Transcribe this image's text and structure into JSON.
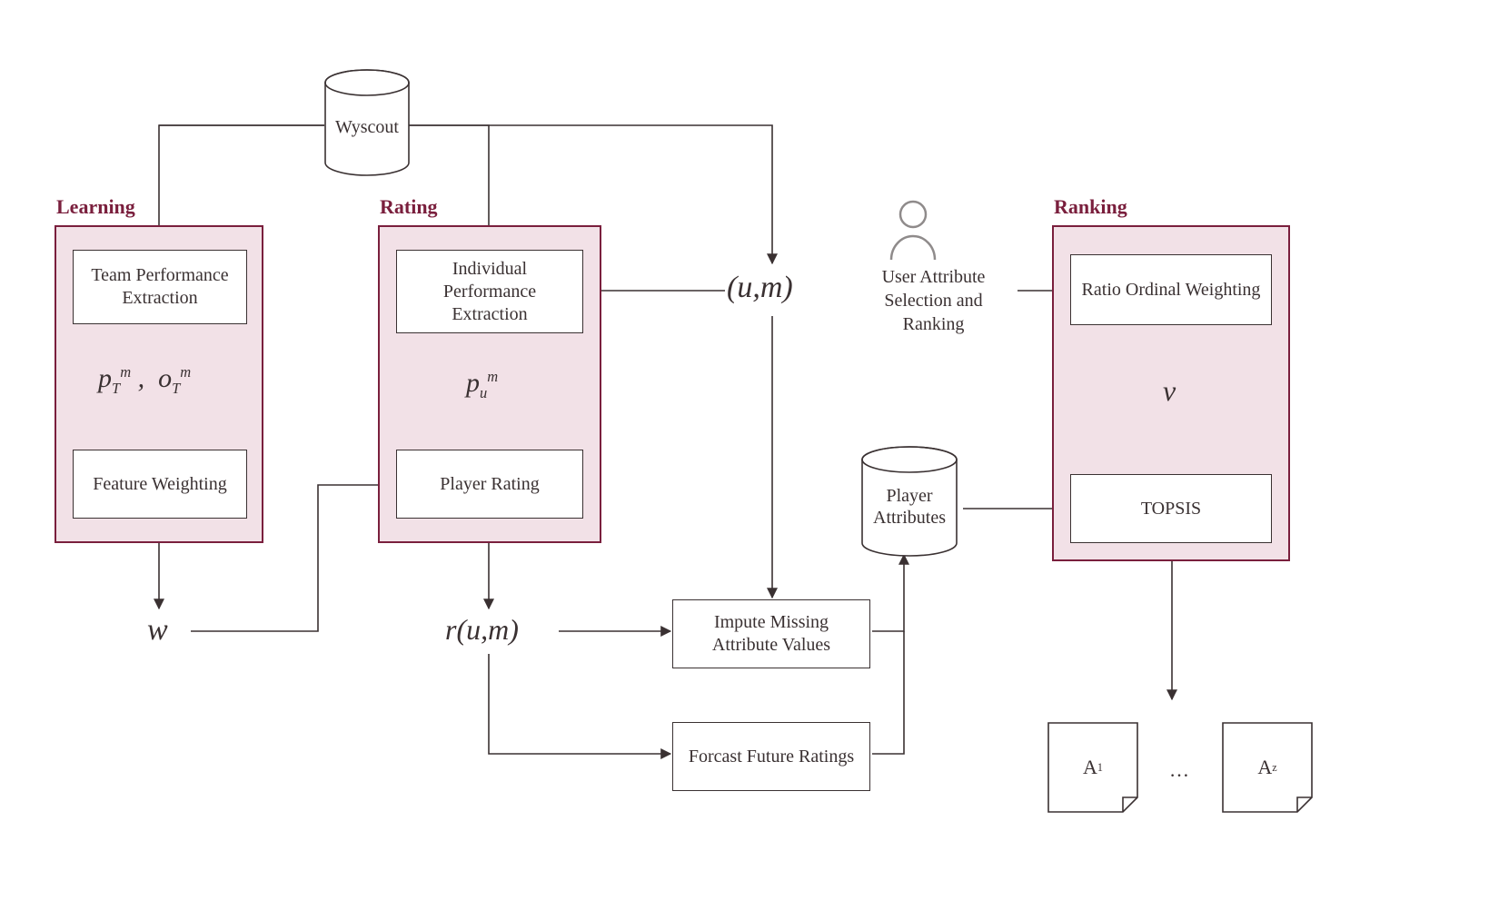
{
  "source_db": "Wyscout",
  "phases": {
    "learning": "Learning",
    "rating": "Rating",
    "ranking": "Ranking"
  },
  "nodes": {
    "team_perf": "Team Performance Extraction",
    "feature_weighting": "Feature Weighting",
    "indiv_perf": "Individual Performance Extraction",
    "player_rating": "Player Rating",
    "impute": "Impute Missing Attribute Values",
    "forecast": "Forcast Future Ratings",
    "ratio_ordinal": "Ratio Ordinal Weighting",
    "topsis": "TOPSIS",
    "player_attributes_db": "Player Attributes"
  },
  "actor": {
    "caption": "User Attribute Selection and Ranking"
  },
  "symbols": {
    "learning_output_html": "p<span class='sub'>T</span><span class='sup'>m</span>&nbsp;,&nbsp;&nbsp;o<span class='sub'>T</span><span class='sup'>m</span>",
    "w": "w",
    "rating_mid_html": "p<span class='sub'>u</span><span class='sup'>m</span>",
    "r_um": "r(u,m)",
    "tuple_um": "(u,m)",
    "v": "v"
  },
  "outputs": {
    "first_sub": "1",
    "last_sub": "z",
    "ellipsis": "…"
  }
}
